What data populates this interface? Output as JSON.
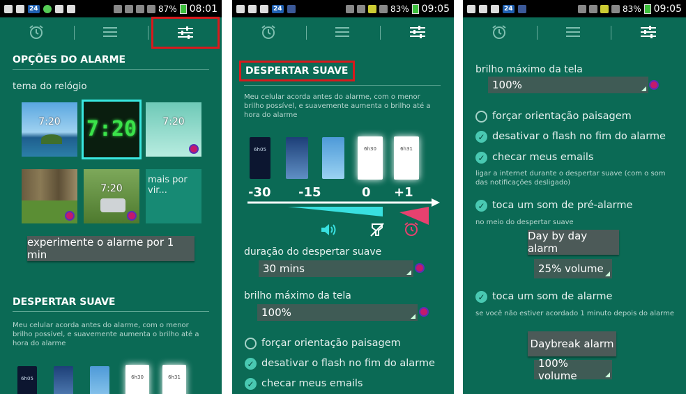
{
  "status": {
    "p1": {
      "battery": "87%",
      "time": "08:01",
      "badge": "24"
    },
    "p2": {
      "battery": "83%",
      "time": "09:05",
      "badge": "24"
    },
    "p3": {
      "battery": "83%",
      "time": "09:05",
      "badge": "24"
    }
  },
  "tabs": [
    "alarm-clock-icon",
    "menu-icon",
    "settings-sliders-icon"
  ],
  "p1": {
    "section_title": "OPÇÕES DO ALARME",
    "clock_theme_label": "tema do relógio",
    "themes": [
      {
        "time": "7:20"
      },
      {
        "time": "7:20"
      },
      {
        "time": "7:20"
      },
      {
        "time": ""
      },
      {
        "time": "7:20"
      }
    ],
    "more_label": "mais por vir...",
    "try_button": "experimente o alarme por 1 min",
    "section2_title": "DESPERTAR SUAVE",
    "section2_desc": "Meu celular acorda antes do alarme, com o menor brilho possível, e suavemente aumenta o brilho até a hora do alarme",
    "mini_times": [
      "6h05",
      "",
      "",
      "6h30",
      "6h31"
    ]
  },
  "p2": {
    "section_title": "DESPERTAR SUAVE",
    "desc": "Meu celular acorda antes do alarme, com o menor brilho possível, e suavemente aumenta o brilho até a hora do alarme",
    "mini_times": [
      "6h05",
      "",
      "",
      "6h30",
      "6h31"
    ],
    "timeline_labels": [
      "-30",
      "-15",
      "0",
      "+1"
    ],
    "duration_label": "duração do despertar suave",
    "duration_value": "30 mins",
    "brightness_label": "brilho máximo da tela",
    "brightness_value": "100%",
    "force_landscape": "forçar orientação paisagem",
    "disable_flash": "desativar o flash no fim do alarme",
    "check_emails": "checar meus emails"
  },
  "p3": {
    "brightness_label": "brilho máximo da tela",
    "brightness_value": "100%",
    "force_landscape": "forçar orientação paisagem",
    "disable_flash": "desativar o flash no fim do alarme",
    "check_emails": "checar meus emails",
    "check_emails_desc": "ligar a internet durante o despertar suave (com o som das notificações desligado)",
    "pre_alarm": "toca um som de pré-alarme",
    "pre_alarm_desc": "no meio do despertar suave",
    "pre_alarm_sound": "Day by day alarm",
    "pre_alarm_volume": "25% volume",
    "play_alarm": "toca um som de alarme",
    "play_alarm_desc": "se você não estiver acordado 1 minuto depois do alarme",
    "alarm_sound": "Daybreak alarm",
    "alarm_volume": "100% volume"
  },
  "colors": {
    "bg": "#0b6a55",
    "highlight": "#d8191c",
    "accent": "#49c9b2"
  }
}
